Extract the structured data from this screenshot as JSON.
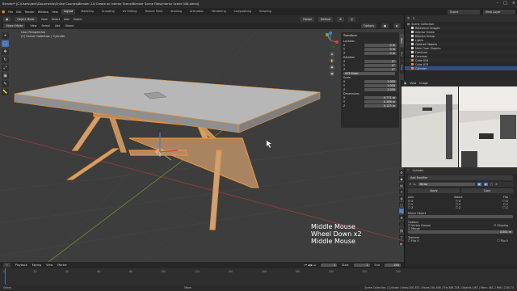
{
  "window": {
    "title": "Blender* [C:\\Users\\dent\\Documents\\Online Courses\\Blender 2.8 Create an Interior Scene\\Blender Scene Files\\Interior Scene 048.blend]",
    "controls": [
      "–",
      "□",
      "×"
    ]
  },
  "menubar": {
    "menus": [
      "File",
      "Edit",
      "Render",
      "Window",
      "Help"
    ],
    "tabs": [
      "Layout",
      "Modeling",
      "Sculpting",
      "UV Editing",
      "Texture Paint",
      "Shading",
      "Animation",
      "Rendering",
      "Compositing",
      "Scripting"
    ],
    "active_tab": "Layout",
    "scene_label": "Scene",
    "view_layer_label": "View Layer"
  },
  "toolheader": {
    "items": [
      "Object Mode",
      "View",
      "Select",
      "Add",
      "Object"
    ],
    "transform": "Global",
    "pivot": "Default"
  },
  "viewheader": {
    "items": [
      "Object Mode",
      "View",
      "Select",
      "Add",
      "Object"
    ],
    "options_label": "Options"
  },
  "viewport": {
    "overlay_line1": "User Perspective",
    "overlay_line2": "(1) Scene Collection | Cylinder",
    "keys": [
      "Middle Mouse",
      "Wheel Down x2",
      "Middle Mouse"
    ],
    "colors": {
      "background": "#3d3d3d",
      "grid": "#474747",
      "xaxis": "#9a3a3a",
      "yaxis": "#6f8c2f",
      "selection": "#e8923a",
      "tabletop": "#a8a8a8"
    }
  },
  "tools": [
    "cursor-icon",
    "move-icon",
    "rotate-icon",
    "scale-icon",
    "transform-icon",
    "annotate-icon",
    "measure-icon"
  ],
  "npanel": {
    "title": "Transform",
    "location_label": "Location",
    "location": [
      {
        "axis": "X",
        "value": "0 m"
      },
      {
        "axis": "Y",
        "value": "0 m"
      },
      {
        "axis": "Z",
        "value": "0 m"
      }
    ],
    "rotation_label": "Rotation",
    "rotation": [
      {
        "axis": "X",
        "value": "0°"
      },
      {
        "axis": "Y",
        "value": "0°"
      },
      {
        "axis": "Z",
        "value": "0°"
      }
    ],
    "mode_label": "XYZ Euler",
    "scale_label": "Scale",
    "scale": [
      {
        "axis": "X",
        "value": "1.000"
      },
      {
        "axis": "Y",
        "value": "1.000"
      },
      {
        "axis": "Z",
        "value": "1.000"
      }
    ],
    "dimensions_label": "Dimensions",
    "dimensions": [
      {
        "axis": "X",
        "value": "0.771 m"
      },
      {
        "axis": "Y",
        "value": "0.186 m"
      },
      {
        "axis": "Z",
        "value": "0.125 m"
      }
    ],
    "tabs": [
      "Item",
      "Tool",
      "View"
    ]
  },
  "outliner": {
    "title": "Scene Collection",
    "items": [
      "Reference Images",
      "Interior Frame",
      "Kitchen Group",
      "Lights",
      "Cabinet Objects",
      "Main Floor Objects",
      "Furniture",
      "Cameras",
      "Cube.024",
      "Cube.025",
      "Cylinder"
    ]
  },
  "imgpanel": {
    "view": "View",
    "image": "Image"
  },
  "properties": {
    "object_name": "Cylinder",
    "add_modifier": "Add Modifier",
    "modifier_name": "Mirror",
    "apply": "Apply",
    "copy": "Copy",
    "axis_label": "Axis",
    "bisect_label": "Bisect",
    "flip_label": "Flip",
    "axes": [
      "X",
      "Y",
      "Z"
    ],
    "mirror_object_label": "Mirror Object",
    "options_label": "Options",
    "merge_label": "Merge",
    "merge_limit": "0.001 m",
    "vertex_groups": "Vertex Groups",
    "clipping": "Clipping",
    "textures": "Textures",
    "flip_u": "Flip U",
    "flip_v": "Flip V"
  },
  "timeline": {
    "menus": [
      "Playback",
      "Keying",
      "View",
      "Marker"
    ],
    "frame": "1",
    "start_label": "Start",
    "start": "1",
    "end_label": "End",
    "end": "250",
    "ticks": [
      "0",
      "20",
      "40",
      "60",
      "80",
      "100",
      "120",
      "140",
      "160",
      "180",
      "200",
      "220",
      "240"
    ]
  },
  "statusbar": {
    "left": "Select",
    "middle": "Move",
    "right": "Scene Collection | Cylinder | Verts:200,352 | Faces:194,938 | Tris:389,728 | Objects:1/67 | Mem: 481.2 MiB | 2.80.74"
  }
}
